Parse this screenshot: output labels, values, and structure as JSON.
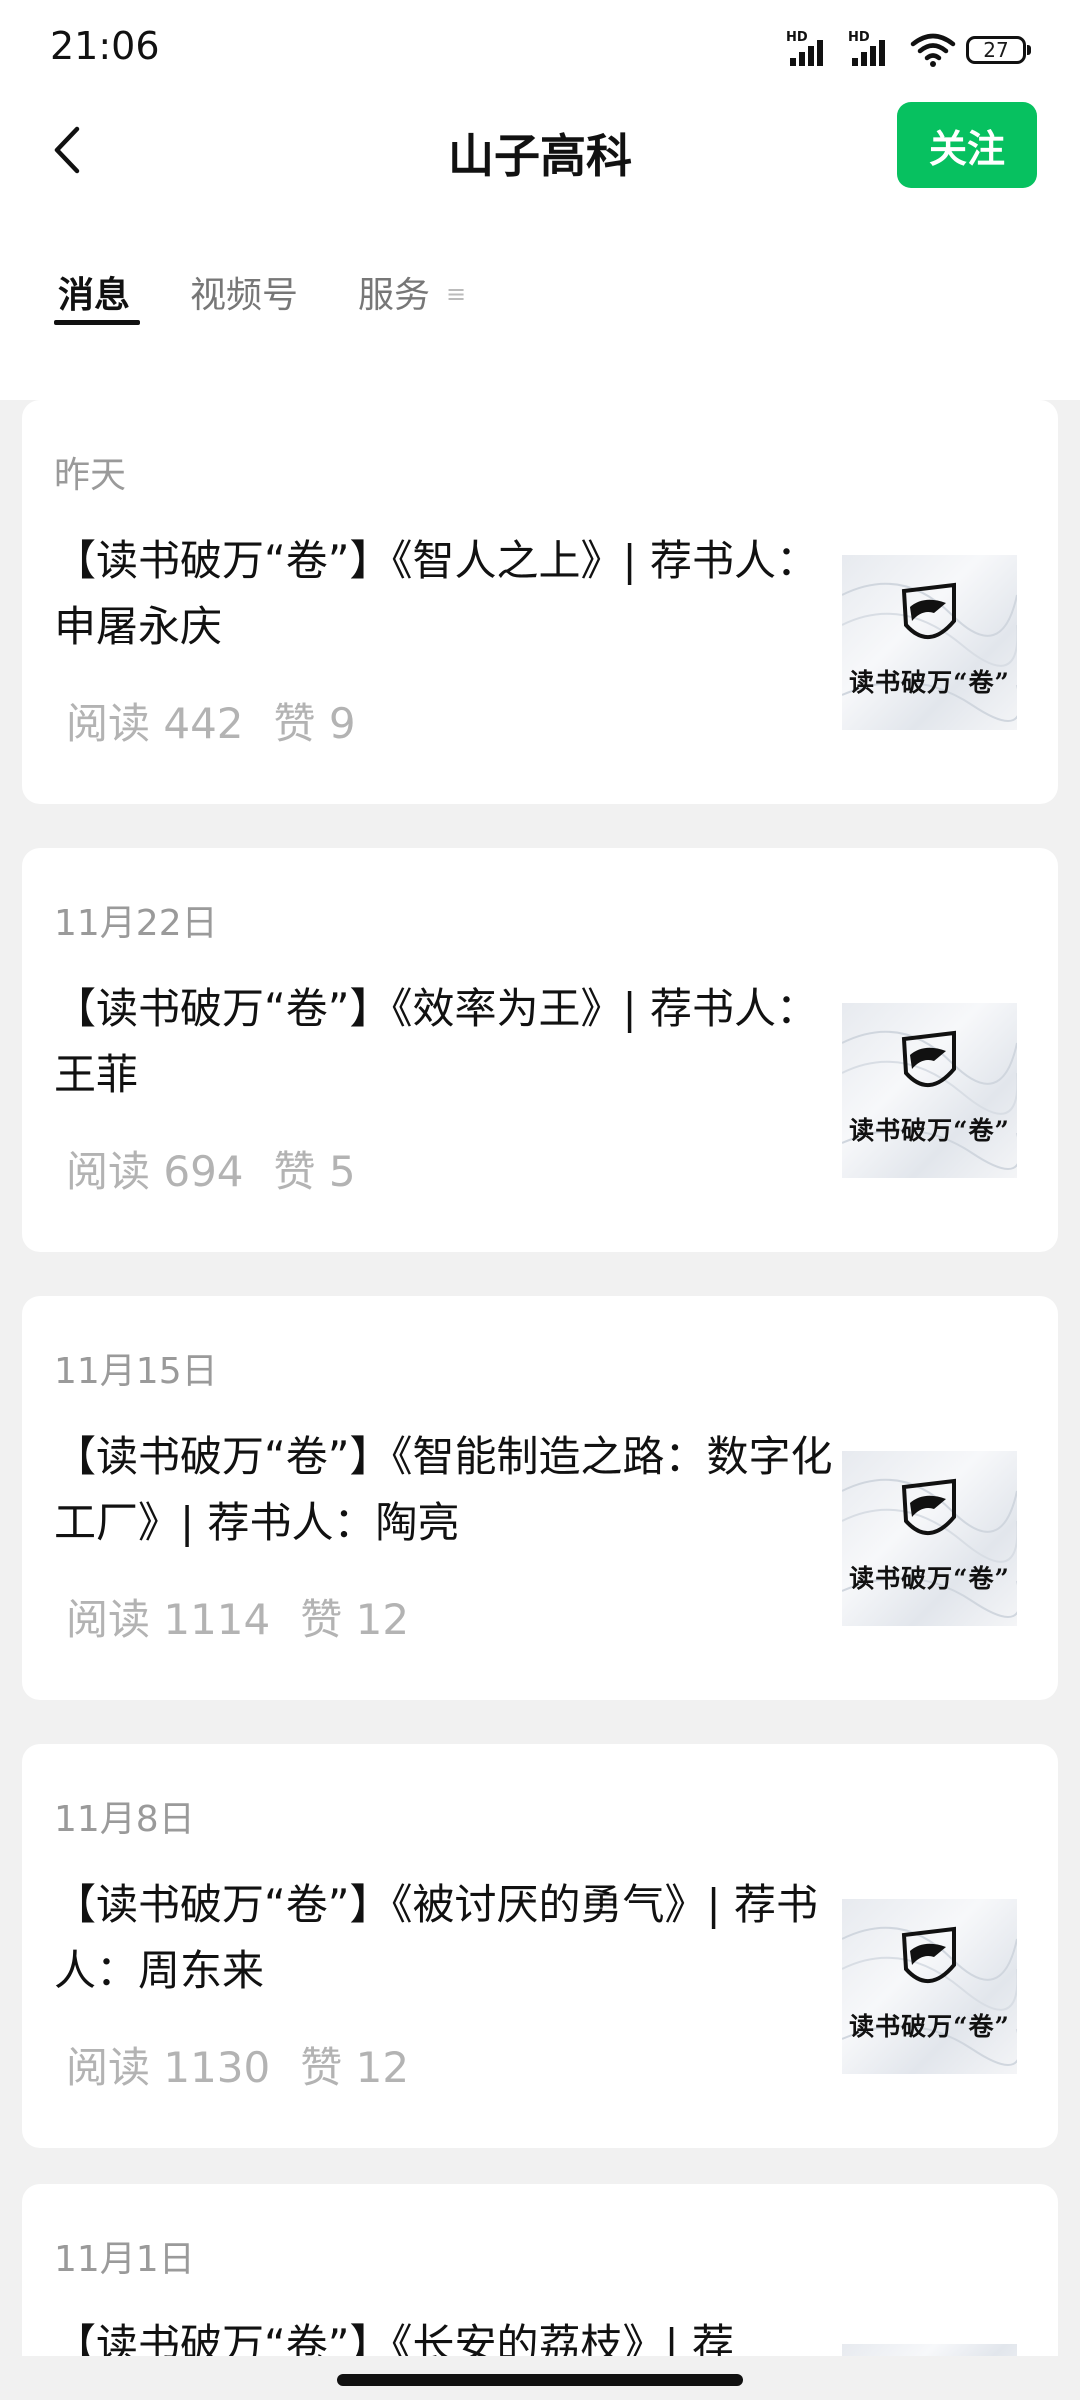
{
  "status_bar": {
    "time": "21:06",
    "sim1": "HD",
    "sim2": "HD",
    "battery": "27"
  },
  "header": {
    "title": "山子高科",
    "follow_label": "关注"
  },
  "tabs": [
    {
      "label": "消息",
      "active": true
    },
    {
      "label": "视频号",
      "active": false
    },
    {
      "label": "服务",
      "active": false
    }
  ],
  "articles": [
    {
      "date": "昨天",
      "title": "【读书破万“卷”】《智人之上》| 荐书人：申屠永庆",
      "reads": "阅读 442",
      "likes": "赞 9",
      "thumb_text": "读书破万“卷”"
    },
    {
      "date": "11月22日",
      "title": "【读书破万“卷”】《效率为王》| 荐书人：王菲",
      "reads": "阅读 694",
      "likes": "赞 5",
      "thumb_text": "读书破万“卷”"
    },
    {
      "date": "11月15日",
      "title": "【读书破万“卷”】《智能制造之路：数字化工厂》| 荐书人：陶亮",
      "reads": "阅读 1114",
      "likes": "赞 12",
      "thumb_text": "读书破万“卷”"
    },
    {
      "date": "11月8日",
      "title": "【读书破万“卷”】《被讨厌的勇气》| 荐书人：周东来",
      "reads": "阅读 1130",
      "likes": "赞 12",
      "thumb_text": "读书破万“卷”"
    },
    {
      "date": "11月1日",
      "title": "【读书破万“卷”】《长安的荔枝》| 荐",
      "reads": "",
      "likes": "",
      "thumb_text": ""
    }
  ],
  "colors": {
    "accent": "#07c160",
    "background": "#f1f1f1",
    "muted_text": "#9a9a9a"
  },
  "icons": [
    "back-arrow-icon",
    "signal-icon",
    "wifi-icon",
    "battery-icon",
    "more-icon"
  ]
}
